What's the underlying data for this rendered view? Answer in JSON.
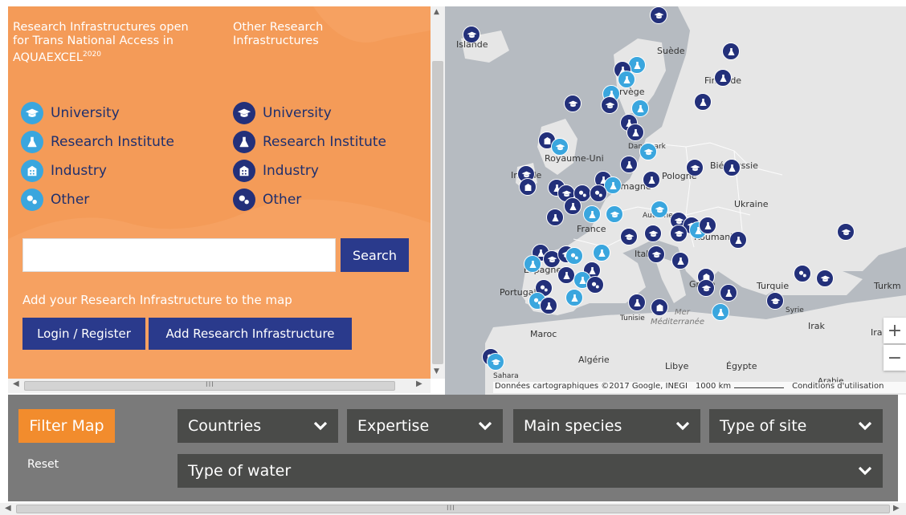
{
  "legend": {
    "aquaexcel_heading": "Research Infrastructures open for Trans National Access in AQUAEXCEL",
    "aquaexcel_sup": "2020",
    "other_heading": "Other Research Infrastructures",
    "aquaexcel_items": [
      {
        "label": "University",
        "icon": "graduation-cap-icon"
      },
      {
        "label": "Research Institute",
        "icon": "flask-icon"
      },
      {
        "label": "Industry",
        "icon": "building-icon"
      },
      {
        "label": "Other",
        "icon": "molecule-icon"
      }
    ],
    "other_items": [
      {
        "label": "University",
        "icon": "graduation-cap-icon"
      },
      {
        "label": "Research Institute",
        "icon": "flask-icon"
      },
      {
        "label": "Industry",
        "icon": "building-icon"
      },
      {
        "label": "Other",
        "icon": "molecule-icon"
      }
    ]
  },
  "search": {
    "value": "",
    "button_label": "Search"
  },
  "add_section": {
    "text": "Add your Research Infrastructure to the map",
    "login_label": "Login / Register",
    "add_label": "Add Research Infrastructure"
  },
  "map": {
    "labels": {
      "islande": "Islande",
      "suede": "Suède",
      "finlande": "Finlande",
      "norvege": "Norvège",
      "danemark": "Danemark",
      "royaume_uni": "Royaume-Uni",
      "irlande": "Irlande",
      "allemagne": "Allemagne",
      "pologne": "Pologne",
      "bielorussie": "Biélorussie",
      "ukraine": "Ukraine",
      "france": "France",
      "autriche": "Autriche",
      "roumanie": "Roumanie",
      "italie": "Italie",
      "espagne": "Espagne",
      "portugal": "Portugal",
      "grece": "Grèce",
      "turquie": "Turquie",
      "turkmenistan": "Turkm",
      "syrie": "Syrie",
      "irak": "Irak",
      "iran": "Ira",
      "tunisie": "Tunisie",
      "mer": "Mer",
      "mediterranee": "Méditerranée",
      "maroc": "Maroc",
      "algerie": "Algérie",
      "libye": "Libye",
      "egypte": "Égypte",
      "sahara": "Sahara",
      "arabie": "Arabie"
    },
    "attribution": "Données cartographiques ©2017 Google, INEGI",
    "scale_label": "1000 km",
    "terms": "Conditions d'utilisation",
    "zoom_in": "+",
    "zoom_out": "−"
  },
  "filters": {
    "title": "Filter Map",
    "reset": "Reset",
    "countries": "Countries",
    "expertise": "Expertise",
    "main_species": "Main species",
    "type_of_site": "Type of site",
    "type_of_water": "Type of water"
  },
  "scrollbar_grip": "III",
  "colors": {
    "panel_orange": "#f49b58",
    "filter_orange": "#f28c2d",
    "navy": "#2a3a8c",
    "marker_light": "#3aa6de",
    "marker_dark": "#23307a",
    "filter_bg": "#7a7a7a",
    "select_bg": "#4a4b49"
  }
}
